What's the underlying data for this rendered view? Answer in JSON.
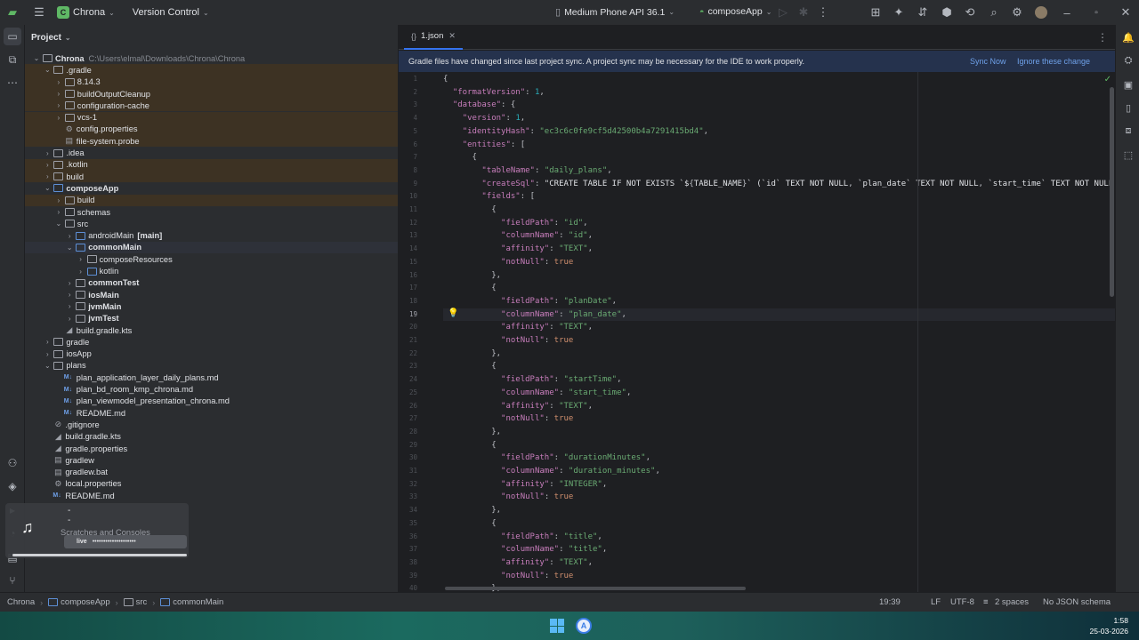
{
  "titlebar": {
    "project_badge": "C",
    "project_name": "Chrona",
    "vcs": "Version Control",
    "device": "Medium Phone API 36.1",
    "run_config": "composeApp"
  },
  "project_panel": {
    "title": "Project",
    "tree": [
      {
        "label": "Chrona",
        "path": "C:\\Users\\elmal\\Downloads\\Chrona\\Chrona",
        "arrow": "⌄",
        "icon": "folder",
        "indent": 0,
        "style": "bold"
      },
      {
        "label": ".gradle",
        "arrow": "⌄",
        "icon": "folder",
        "indent": 1,
        "hl": true
      },
      {
        "label": "8.14.3",
        "arrow": "›",
        "icon": "folder",
        "indent": 2,
        "hl": true
      },
      {
        "label": "buildOutputCleanup",
        "arrow": "›",
        "icon": "folder",
        "indent": 2,
        "hl": true
      },
      {
        "label": "configuration-cache",
        "arrow": "›",
        "icon": "folder",
        "indent": 2,
        "hl": true
      },
      {
        "label": "vcs-1",
        "arrow": "›",
        "icon": "folder",
        "indent": 2,
        "hl": true
      },
      {
        "label": "config.properties",
        "arrow": "",
        "icon": "gear",
        "indent": 2,
        "hl": true
      },
      {
        "label": "file-system.probe",
        "arrow": "",
        "icon": "file",
        "indent": 2,
        "hl": true
      },
      {
        "label": ".idea",
        "arrow": "›",
        "icon": "folder",
        "indent": 1
      },
      {
        "label": ".kotlin",
        "arrow": "›",
        "icon": "folder",
        "indent": 1,
        "hl": true
      },
      {
        "label": "build",
        "arrow": "›",
        "icon": "folder",
        "indent": 1,
        "hl": true
      },
      {
        "label": "composeApp",
        "arrow": "⌄",
        "icon": "module",
        "indent": 1,
        "style": "bold"
      },
      {
        "label": "build",
        "arrow": "›",
        "icon": "folder",
        "indent": 2,
        "hl": true
      },
      {
        "label": "schemas",
        "arrow": "›",
        "icon": "folder",
        "indent": 2
      },
      {
        "label": "src",
        "arrow": "⌄",
        "icon": "folder",
        "indent": 2
      },
      {
        "label": "androidMain",
        "suffix": "[main]",
        "arrow": "›",
        "icon": "module",
        "indent": 3
      },
      {
        "label": "commonMain",
        "arrow": "⌄",
        "icon": "module",
        "indent": 3,
        "style": "bold",
        "sel": true
      },
      {
        "label": "composeResources",
        "arrow": "›",
        "icon": "folder",
        "indent": 4
      },
      {
        "label": "kotlin",
        "arrow": "›",
        "icon": "module",
        "indent": 4
      },
      {
        "label": "commonTest",
        "arrow": "›",
        "icon": "folder",
        "indent": 3,
        "style": "bold"
      },
      {
        "label": "iosMain",
        "arrow": "›",
        "icon": "folder",
        "indent": 3,
        "style": "bold"
      },
      {
        "label": "jvmMain",
        "arrow": "›",
        "icon": "folder",
        "indent": 3,
        "style": "bold"
      },
      {
        "label": "jvmTest",
        "arrow": "›",
        "icon": "folder",
        "indent": 3,
        "style": "bold"
      },
      {
        "label": "build.gradle.kts",
        "arrow": "",
        "icon": "gradle",
        "indent": 2
      },
      {
        "label": "gradle",
        "arrow": "›",
        "icon": "folder",
        "indent": 1
      },
      {
        "label": "iosApp",
        "arrow": "›",
        "icon": "folder",
        "indent": 1
      },
      {
        "label": "plans",
        "arrow": "⌄",
        "icon": "folder",
        "indent": 1
      },
      {
        "label": "plan_application_layer_daily_plans.md",
        "arrow": "",
        "icon": "md",
        "indent": 2
      },
      {
        "label": "plan_bd_room_kmp_chrona.md",
        "arrow": "",
        "icon": "md",
        "indent": 2
      },
      {
        "label": "plan_viewmodel_presentation_chrona.md",
        "arrow": "",
        "icon": "md",
        "indent": 2
      },
      {
        "label": "README.md",
        "arrow": "",
        "icon": "md",
        "indent": 2
      },
      {
        "label": ".gitignore",
        "arrow": "",
        "icon": "ignore",
        "indent": 1
      },
      {
        "label": "build.gradle.kts",
        "arrow": "",
        "icon": "gradle",
        "indent": 1
      },
      {
        "label": "gradle.properties",
        "arrow": "",
        "icon": "gradle",
        "indent": 1
      },
      {
        "label": "gradlew",
        "arrow": "",
        "icon": "file",
        "indent": 1
      },
      {
        "label": "gradlew.bat",
        "arrow": "",
        "icon": "file",
        "indent": 1
      },
      {
        "label": "local.properties",
        "arrow": "",
        "icon": "gear",
        "indent": 1
      },
      {
        "label": "README.md",
        "arrow": "",
        "icon": "md",
        "indent": 1
      }
    ],
    "behind_popup": "Scratches and Consoles"
  },
  "editor": {
    "tab_label": "1.json",
    "banner_text": "Gradle files have changed since last project sync. A project sync may be necessary for the IDE to work properly.",
    "banner_sync": "Sync Now",
    "banner_ignore": "Ignore these change",
    "current_line": 19,
    "lines": [
      "{",
      "  \"formatVersion\": 1,",
      "  \"database\": {",
      "    \"version\": 1,",
      "    \"identityHash\": \"ec3c6c0fe9cf5d42500b4a7291415bd4\",",
      "    \"entities\": [",
      "      {",
      "        \"tableName\": \"daily_plans\",",
      "        \"createSql\": \"CREATE TABLE IF NOT EXISTS `${TABLE_NAME}` (`id` TEXT NOT NULL, `plan_date` TEXT NOT NULL, `start_time` TEXT NOT NULL, `",
      "        \"fields\": [",
      "          {",
      "            \"fieldPath\": \"id\",",
      "            \"columnName\": \"id\",",
      "            \"affinity\": \"TEXT\",",
      "            \"notNull\": true",
      "          },",
      "          {",
      "            \"fieldPath\": \"planDate\",",
      "            \"columnName\": \"plan_date\",",
      "            \"affinity\": \"TEXT\",",
      "            \"notNull\": true",
      "          },",
      "          {",
      "            \"fieldPath\": \"startTime\",",
      "            \"columnName\": \"start_time\",",
      "            \"affinity\": \"TEXT\",",
      "            \"notNull\": true",
      "          },",
      "          {",
      "            \"fieldPath\": \"durationMinutes\",",
      "            \"columnName\": \"duration_minutes\",",
      "            \"affinity\": \"INTEGER\",",
      "            \"notNull\": true",
      "          },",
      "          {",
      "            \"fieldPath\": \"title\",",
      "            \"columnName\": \"title\",",
      "            \"affinity\": \"TEXT\",",
      "            \"notNull\": true",
      "          },"
    ]
  },
  "statusbar": {
    "breadcrumbs": [
      "Chrona",
      "composeApp",
      "src",
      "commonMain"
    ],
    "position": "19:39",
    "line_sep": "LF",
    "encoding": "UTF-8",
    "indent": "2 spaces",
    "schema": "No JSON schema"
  },
  "taskbar": {
    "time": "1:58",
    "date": "25-03-2026",
    "app_letter": "A"
  },
  "media_popup": {
    "live_label": "live",
    "live_text": "••••••••••••••••••••",
    "dash": "-"
  },
  "colors": {
    "accent": "#3574f0",
    "key": "#c77dbb",
    "string": "#6aab73",
    "number": "#2aacb8",
    "keyword": "#cf8e6d",
    "excluded_bg": "#3d3223"
  }
}
